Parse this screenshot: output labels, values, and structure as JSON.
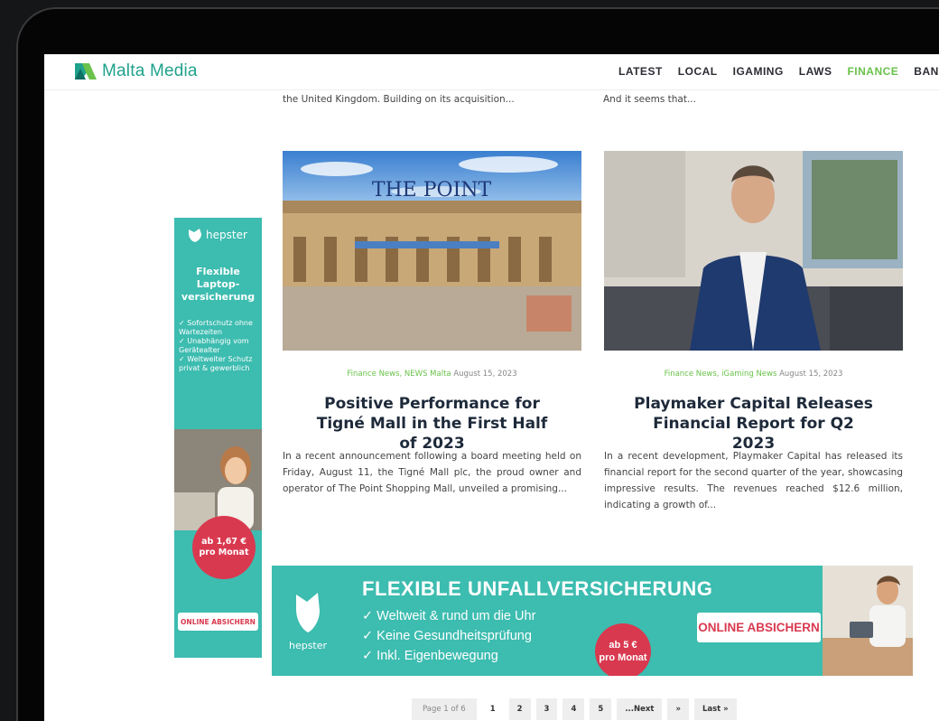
{
  "brand": {
    "name": "Malta Media",
    "color": "#1fa28c"
  },
  "nav": {
    "items": [
      "LATEST",
      "LOCAL",
      "IGAMING",
      "LAWS",
      "FINANCE",
      "BANKING"
    ],
    "active": "FINANCE",
    "active_color": "#6ac24b"
  },
  "top_excerpts": {
    "left": "the United Kingdom. Building on its acquisition...",
    "right": "And it seems that..."
  },
  "articles": [
    {
      "image_caption": "THE POINT",
      "categories": "Finance News, NEWS Malta",
      "date": "August 15, 2023",
      "title": "Positive Performance for Tigné Mall in the First Half of 2023",
      "excerpt": "In a recent announcement following a board meeting held on Friday, August 11, the Tigné Mall plc, the proud owner and operator of The Point Shopping Mall, unveiled a promising..."
    },
    {
      "image_caption": "",
      "categories": "Finance News, iGaming News",
      "date": "August 15, 2023",
      "title": "Playmaker Capital Releases Financial Report for Q2 2023",
      "excerpt": "In a recent development, Playmaker Capital has released its financial report for the second quarter of the year, showcasing impressive results. The revenues reached $12.6 million, indicating a growth of..."
    }
  ],
  "side_ad": {
    "brand": "hepster",
    "title": "Flexible Laptop-versicherung",
    "bullets": [
      "✓ Sofortschutz ohne Wartezeiten",
      "✓ Unabhängig vom Gerätealter",
      "✓ Weltweiter Schutz privat & gewerblich"
    ],
    "price_line1": "ab 1,67 €",
    "price_line2": "pro Monat",
    "cta": "ONLINE ABSICHERN",
    "colors": {
      "background": "#3dbcb0",
      "accent": "#d9394f"
    }
  },
  "banner_ad": {
    "brand": "hepster",
    "title": "FLEXIBLE UNFALLVERSICHERUNG",
    "bullets": [
      "✓ Weltweit & rund um die Uhr",
      "✓ Keine Gesundheitsprüfung",
      "✓ Inkl. Eigenbewegung"
    ],
    "price_line1": "ab 5 €",
    "price_line2": "pro Monat",
    "cta": "ONLINE ABSICHERN"
  },
  "pagination": {
    "info": "Page 1 of 6",
    "pages": [
      "1",
      "2",
      "3",
      "4",
      "5"
    ],
    "current": "1",
    "next": "...Next",
    "next_arrow": "»",
    "last": "Last »"
  }
}
